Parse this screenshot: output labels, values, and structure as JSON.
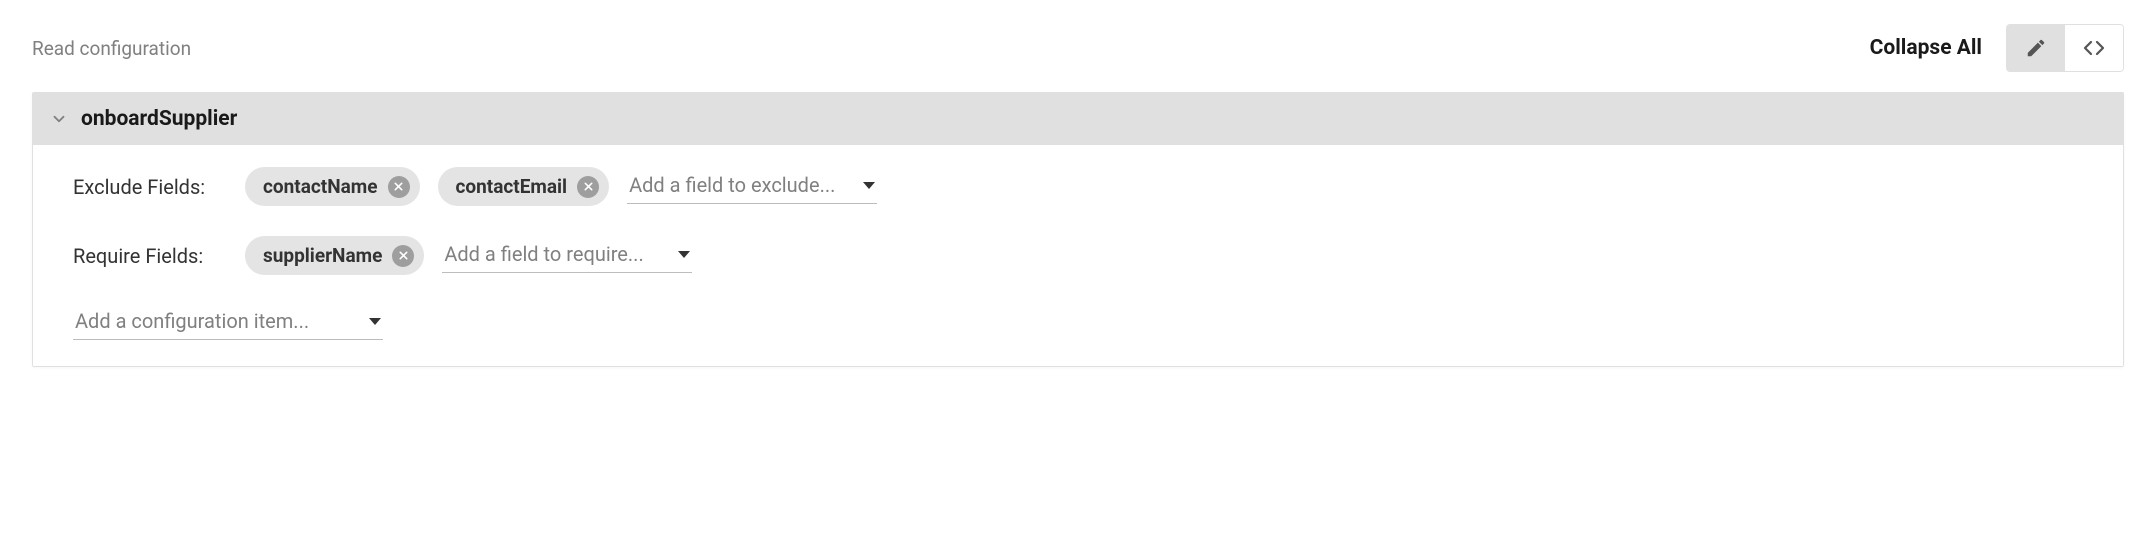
{
  "header": {
    "title": "Read configuration",
    "collapse_all": "Collapse All"
  },
  "section": {
    "title": "onboardSupplier"
  },
  "exclude": {
    "label": "Exclude Fields:",
    "chips": [
      "contactName",
      "contactEmail"
    ],
    "placeholder": "Add a field to exclude..."
  },
  "require": {
    "label": "Require Fields:",
    "chips": [
      "supplierName"
    ],
    "placeholder": "Add a field to require..."
  },
  "add_config": {
    "placeholder": "Add a configuration item..."
  }
}
